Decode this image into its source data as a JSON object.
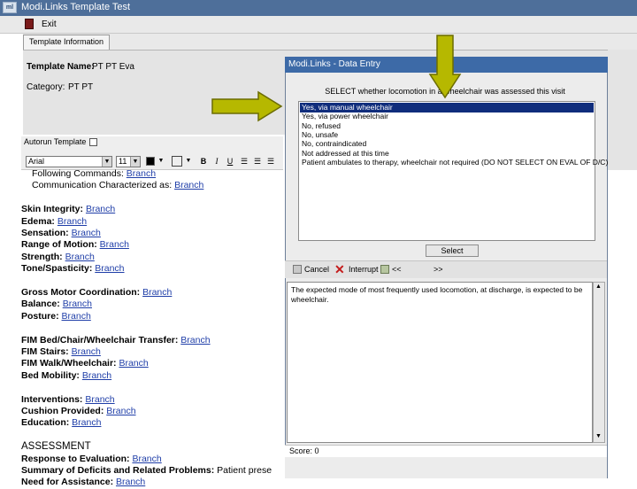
{
  "window": {
    "app_name": "Modi.Links",
    "title": "Modi.Links   Template Test",
    "logo_text": "ml"
  },
  "menubar": {
    "exit_label": "Exit"
  },
  "tabs": [
    {
      "label": "Template Information"
    }
  ],
  "template_info": {
    "name_label": "Template Name:",
    "name_value": "PT PT Eva",
    "category_label": "Category:",
    "category_value": "PT PT"
  },
  "left_toolbar": {
    "autorun_label": "Autorun Template",
    "font_value": "Arial",
    "size_value": "11",
    "bold_icon": "B",
    "italic_icon": "I",
    "underline_icon": "U"
  },
  "document": {
    "link_text": "Branch",
    "lines": [
      {
        "label": "Following Commands:",
        "link": "Branch",
        "indent": true,
        "bold": false
      },
      {
        "label": "Communication Characterized as:",
        "link": "Branch",
        "indent": true,
        "bold": false
      },
      {
        "label": "",
        "link": "",
        "spacer": true
      },
      {
        "label": "Skin Integrity:",
        "link": "Branch"
      },
      {
        "label": "Edema:",
        "link": "Branch"
      },
      {
        "label": "Sensation:",
        "link": "Branch"
      },
      {
        "label": "Range of Motion:",
        "link": "Branch"
      },
      {
        "label": "Strength:",
        "link": "Branch"
      },
      {
        "label": "Tone/Spasticity:",
        "link": "Branch"
      },
      {
        "label": "",
        "link": "",
        "spacer": true
      },
      {
        "label": "Gross Motor Coordination:",
        "link": "Branch"
      },
      {
        "label": "Balance:",
        "link": "Branch"
      },
      {
        "label": "Posture:",
        "link": "Branch"
      },
      {
        "label": "",
        "link": "",
        "spacer": true
      },
      {
        "label": "FIM Bed/Chair/Wheelchair Transfer:",
        "link": "Branch"
      },
      {
        "label": "FIM Stairs:",
        "link": "Branch"
      },
      {
        "label": "FIM Walk/Wheelchair:",
        "link": "Branch"
      },
      {
        "label": "Bed Mobility:",
        "link": "Branch"
      },
      {
        "label": "",
        "link": "",
        "spacer": true
      },
      {
        "label": "Interventions:",
        "link": "Branch"
      },
      {
        "label": "Cushion Provided:",
        "link": "Branch"
      },
      {
        "label": "Education:",
        "link": "Branch"
      },
      {
        "label": "",
        "link": "",
        "spacer": true
      },
      {
        "label": "ASSESSMENT",
        "link": "",
        "heading": true
      },
      {
        "label": "Response to Evaluation:",
        "link": "Branch"
      },
      {
        "label": "Summary of Deficits and Related Problems:",
        "link": "",
        "trailing": "Patient prese"
      },
      {
        "label": "Need for Assistance:",
        "link": "Branch"
      }
    ]
  },
  "dialog": {
    "title": "Modi.Links - Data Entry",
    "prompt": "SELECT whether locomotion in a wheelchair was assessed this visit",
    "options": [
      "Yes, via manual wheelchair",
      "Yes, via power wheelchair",
      "No, refused",
      "No, unsafe",
      "No, contraindicated",
      "Not addressed at this time",
      "Patient ambulates to therapy, wheelchair not required (DO NOT SELECT ON EVAL OF D/C)"
    ],
    "selected_index": 0,
    "select_button": "Select",
    "cancel_label": "Cancel",
    "remove_label": "Interrupt",
    "back_label": "<<",
    "forward_label": ">>",
    "result_text": "The expected mode of most frequently used locomotion, at discharge, is expected to be wheelchair.",
    "score_label": "Score: 0"
  },
  "colors": {
    "arrow": "#b6b800",
    "selection": "#102d7c",
    "titlebar": "#4e6f9a",
    "link": "#1f3ea8"
  }
}
